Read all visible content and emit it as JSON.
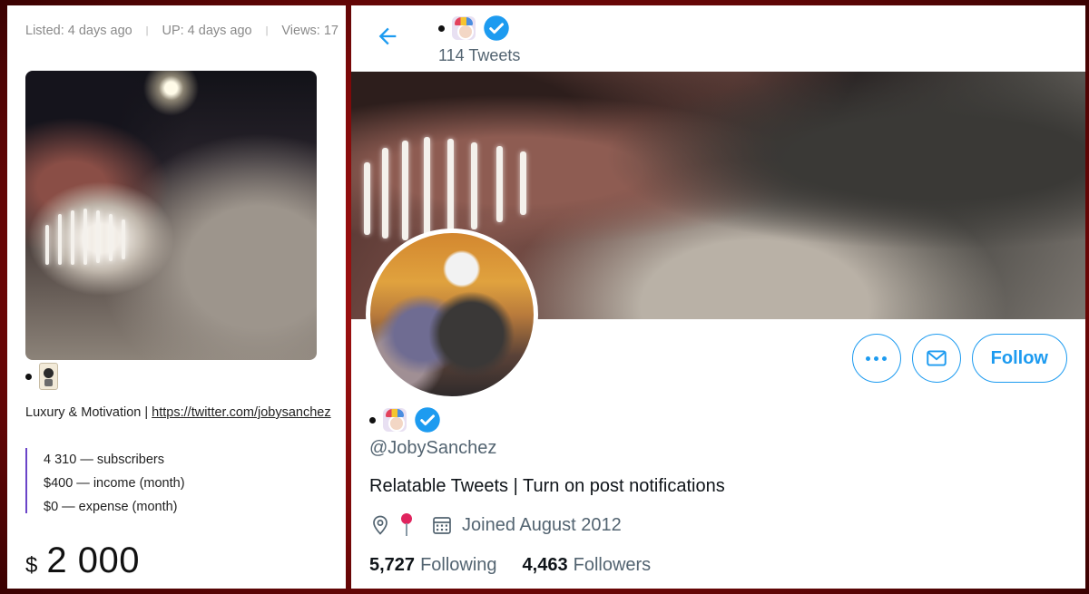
{
  "listing": {
    "listed": "Listed: 4 days ago",
    "up": "UP: 4 days ago",
    "views": "Views: 17",
    "separator": "|",
    "tagline_prefix": "Luxury & Motivation | ",
    "tagline_link": "https://twitter.com/jobysanchez",
    "stats": [
      "4 310 — subscribers",
      "$400 — income (month)",
      "$0 — expense (month)"
    ],
    "price_currency": "$",
    "price_value": "2 000",
    "accent_color": "#6a44c8"
  },
  "profile": {
    "tweets_count": "114 Tweets",
    "handle": "@JobySanchez",
    "bio": "Relatable Tweets | Turn on post notifications",
    "joined": "Joined August 2012",
    "following_count": "5,727",
    "following_label": "Following",
    "followers_count": "4,463",
    "followers_label": "Followers",
    "follow_label": "Follow",
    "accent_color": "#1d9bf0",
    "icons": [
      "back-arrow-icon",
      "verified-icon",
      "more-icon",
      "mail-icon",
      "location-icon",
      "calendar-icon"
    ]
  }
}
